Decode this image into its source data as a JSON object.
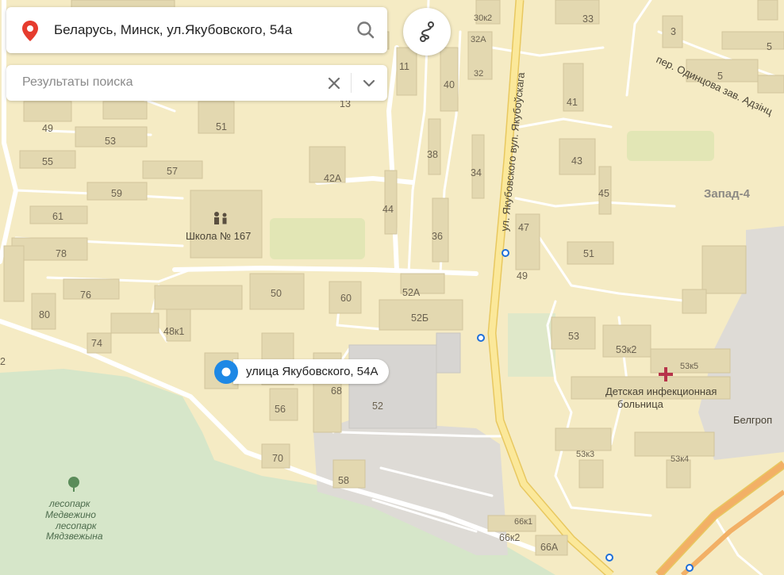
{
  "search": {
    "query": "Беларусь, Минск, ул.Якубовского, 54а",
    "icon": "search-icon",
    "pin_icon": "location-pin-icon",
    "pin_color": "#e63c2e"
  },
  "route_button": {
    "icon": "route-icon"
  },
  "results_panel": {
    "label": "Результаты поиска",
    "close_icon": "close-icon",
    "expand_icon": "chevron-down-icon"
  },
  "result_marker": {
    "label": "улица Якубовского, 54А",
    "color": "#1e88e5"
  },
  "map": {
    "streets": {
      "yakubovskogo_ru": "ул. Якубовского",
      "yakubovskogo_by": "вул. Якубоўскага",
      "odintsova": "пер. Одинцова",
      "odintsova_by": "зав. Адзінц"
    },
    "district": "Запад-4",
    "pois": {
      "school": "Школа № 167",
      "hospital_line1": "Детская инфекционная",
      "hospital_line2": "больница",
      "belgrp": "Белгроп",
      "forest_ru_1": "лесопарк",
      "forest_ru_2": "Медвежино",
      "forest_by_1": "лесопарк",
      "forest_by_2": "Мядзвежына"
    },
    "house_numbers": {
      "h30k2": "30к2",
      "h33": "33",
      "h3": "3",
      "h5a": "5",
      "h5b": "5",
      "h11": "11",
      "h40": "40",
      "h32a": "32А",
      "h32": "32",
      "h41": "41",
      "h13": "13",
      "h49a": "49",
      "h51a": "51",
      "h53a": "53",
      "h55": "55",
      "h57": "57",
      "h59": "59",
      "h61": "61",
      "h42a": "42А",
      "h38": "38",
      "h34": "34",
      "h43": "43",
      "h45": "45",
      "h44": "44",
      "h36": "36",
      "h47": "47",
      "h49b": "49",
      "h51b": "51",
      "h78": "78",
      "h76": "76",
      "h80": "80",
      "h74": "74",
      "h50": "50",
      "h48k1": "48к1",
      "h60": "60",
      "h52a": "52А",
      "h52b": "52Б",
      "h53b": "53",
      "h53k2": "53к2",
      "h53k5": "53к5",
      "h68": "68",
      "h52": "52",
      "h56": "56",
      "h70": "70",
      "h58": "58",
      "h53k3": "53к3",
      "h53k4": "53к4",
      "h66k1": "66к1",
      "h66k2": "66к2",
      "h66a": "66А",
      "h2": "2"
    }
  },
  "colors": {
    "land": "#f5ebc4",
    "forest": "#d6e6c9",
    "building": "#e3d8b0",
    "main_road": "#fbe89a",
    "industrial": "#dedbd6"
  }
}
